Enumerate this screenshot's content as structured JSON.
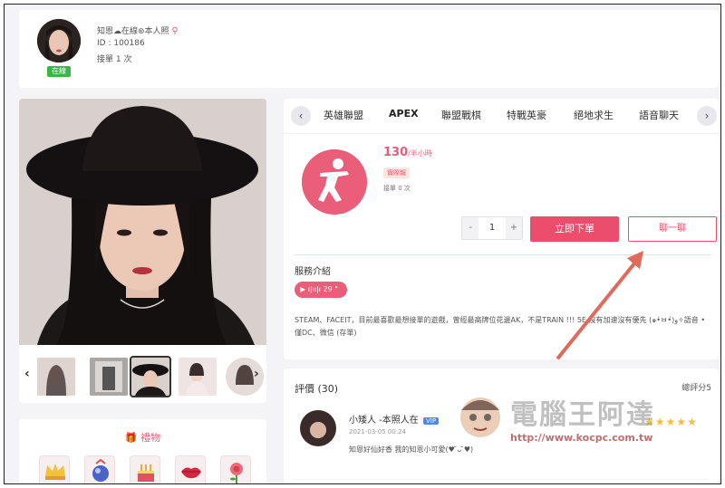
{
  "profile": {
    "name": "知恩☁在線⊛本人照",
    "id": "ID : 100186",
    "orders": "接單 1 次",
    "status": "在線"
  },
  "thumbnails_count": 6,
  "gifts": {
    "title": "禮物"
  },
  "games": {
    "tabs": [
      "英雄聯盟",
      "APEX",
      "聯盟戰棋",
      "特戰英豪",
      "絕地求生",
      "語音聊天"
    ],
    "active_tab": "APEX",
    "price": "130",
    "price_unit": "/半小時",
    "price_tag": "實際報",
    "orders": "接單 0 次",
    "qty": "1",
    "minus": "-",
    "plus": "+",
    "order_button": "立即下單",
    "chat_button": "聊一聊",
    "service_title": "服務介紹",
    "voice_label": "▶ ı|ıı|ı 29 \"",
    "service_text": "STEAM、FACEIT，目前最喜歡最想接單的遊戲，曾經最高牌位花邊AK，不是TRAIN !!! 5E 沒有加速沒有優先 (๑•̀ㅂ•́)و✧語音 • 僅DC、微信 (存單)"
  },
  "reviews": {
    "title": "評價 (30)",
    "score": "總評分5",
    "items": [
      {
        "user": "小矮人 -本照人在",
        "badge": "VIP",
        "date": "2021-03-05 00:24",
        "text": "知恩好仙好香 我的知恩小可愛(♥ ̄ᴗ ̄♥)",
        "rating": 5
      }
    ]
  },
  "watermark": {
    "title": "電腦王阿達",
    "url": "http://www.kocpc.com.tw"
  },
  "colors": {
    "accent": "#ea4e6c",
    "online": "#3cb44b",
    "star": "#f5c12c"
  }
}
